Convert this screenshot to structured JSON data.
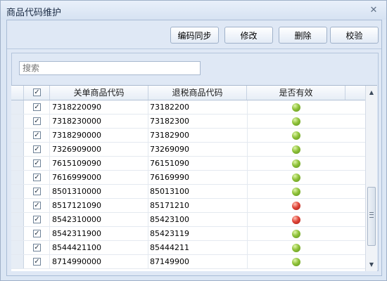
{
  "window": {
    "title": "商品代码维护"
  },
  "toolbar": {
    "sync_label": "编码同步",
    "edit_label": "修改",
    "delete_label": "删除",
    "verify_label": "校验"
  },
  "search": {
    "placeholder": "搜索"
  },
  "table": {
    "columns": [
      "关单商品代码",
      "退税商品代码",
      "是否有效"
    ],
    "rows": [
      {
        "customs_code": "7318220090",
        "rebate_code": "73182200",
        "valid": true
      },
      {
        "customs_code": "7318230000",
        "rebate_code": "73182300",
        "valid": true
      },
      {
        "customs_code": "7318290000",
        "rebate_code": "73182900",
        "valid": true
      },
      {
        "customs_code": "7326909000",
        "rebate_code": "73269090",
        "valid": true
      },
      {
        "customs_code": "7615109090",
        "rebate_code": "76151090",
        "valid": true
      },
      {
        "customs_code": "7616999000",
        "rebate_code": "76169990",
        "valid": true
      },
      {
        "customs_code": "8501310000",
        "rebate_code": "85013100",
        "valid": true
      },
      {
        "customs_code": "8517121090",
        "rebate_code": "85171210",
        "valid": false
      },
      {
        "customs_code": "8542310000",
        "rebate_code": "85423100",
        "valid": false
      },
      {
        "customs_code": "8542311900",
        "rebate_code": "85423119",
        "valid": true
      },
      {
        "customs_code": "8544421100",
        "rebate_code": "85444211",
        "valid": true
      },
      {
        "customs_code": "8714990000",
        "rebate_code": "87149900",
        "valid": true
      }
    ]
  },
  "colors": {
    "valid": "#8fc23a",
    "invalid": "#e0463a"
  }
}
